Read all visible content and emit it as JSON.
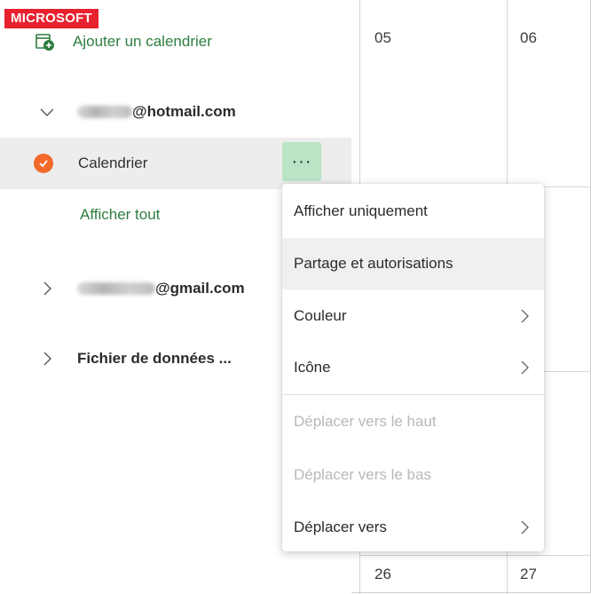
{
  "brand": "MICROSOFT",
  "sidebar": {
    "add_calendar": "Ajouter un calendrier",
    "accounts": [
      {
        "email_suffix": "@hotmail.com",
        "expanded": true
      },
      {
        "email_suffix": "@gmail.com",
        "expanded": false
      },
      {
        "label": "Fichier de données ...",
        "expanded": false
      }
    ],
    "calendar_item": "Calendrier",
    "more_label": "···",
    "show_all": "Afficher tout",
    "check_color": "#f26a2b"
  },
  "calendar": {
    "days": [
      "05",
      "06",
      "26",
      "27"
    ]
  },
  "context_menu": {
    "items": [
      {
        "label": "Afficher uniquement",
        "enabled": true
      },
      {
        "label": "Partage et autorisations",
        "enabled": true
      },
      {
        "label": "Couleur",
        "enabled": true,
        "submenu": true
      },
      {
        "label": "Icône",
        "enabled": true,
        "submenu": true
      },
      {
        "label": "Déplacer vers le haut",
        "enabled": false
      },
      {
        "label": "Déplacer vers le bas",
        "enabled": false
      },
      {
        "label": "Déplacer vers",
        "enabled": true,
        "submenu": true
      }
    ]
  },
  "colors": {
    "accent_green": "#2e7d3f",
    "button_green": "#b9e4c6",
    "brand_red": "#e8212e"
  }
}
